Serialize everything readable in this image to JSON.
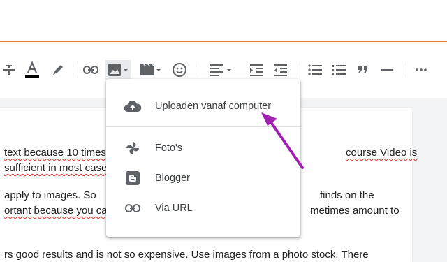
{
  "toolbar": {
    "icons": [
      "strikethrough-icon",
      "text-color-icon",
      "highlight-icon",
      "link-icon",
      "image-icon",
      "video-icon",
      "emoji-icon",
      "align-icon",
      "indent-icon",
      "outdent-icon",
      "bulleted-list-icon",
      "numbered-list-icon",
      "quote-icon",
      "horizontal-rule-icon",
      "more-icon"
    ],
    "text_color_bar": "#000000"
  },
  "image_menu": {
    "upload": "Uploaden vanaf computer",
    "photos": "Foto's",
    "blogger": "Blogger",
    "via_url": "Via URL"
  },
  "content": {
    "l1a": "text because 10 times",
    "l1b": "course Video is",
    "l2": "sufficient in most case",
    "l3a": "apply to images. So",
    "l3b": "finds on the",
    "l4a": "ortant because you ca",
    "l4b": "metimes amount to",
    "l5": "rs good results and is not so expensive. Use images from a photo stock. There"
  },
  "colors": {
    "accent_line": "#e8773f",
    "arrow": "#a020b0",
    "icon": "#5f6368"
  }
}
